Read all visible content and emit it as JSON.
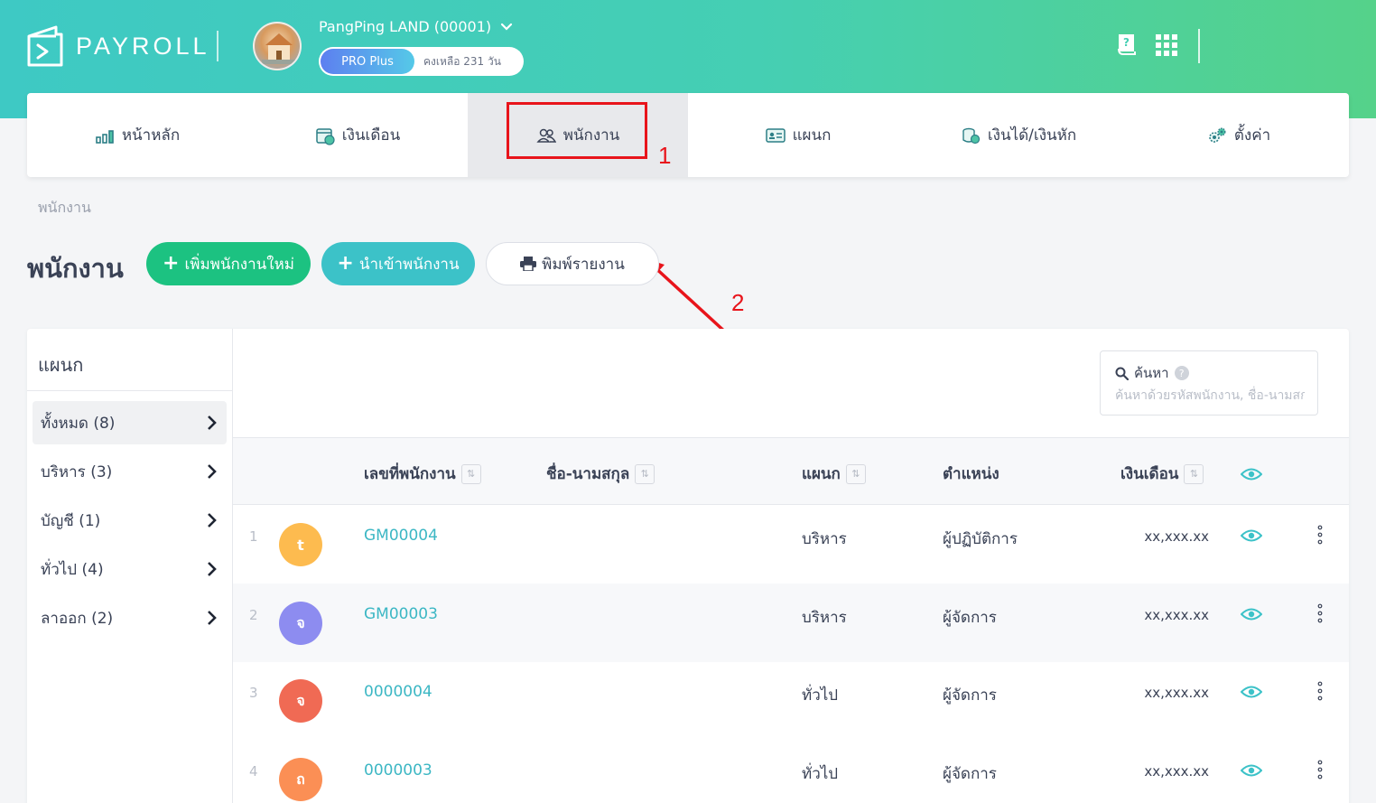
{
  "header": {
    "logo_text": "PAYROLL",
    "company_name": "PangPing LAND (00001)",
    "plan_badge": "PRO Plus",
    "plan_remaining": "คงเหลือ 231 วัน",
    "icons": [
      "help-book-icon",
      "apps-grid-icon"
    ]
  },
  "nav": {
    "items": [
      {
        "label": "หน้าหลัก",
        "icon": "bar-chart-icon"
      },
      {
        "label": "เงินเดือน",
        "icon": "calendar-money-icon"
      },
      {
        "label": "พนักงาน",
        "icon": "people-icon"
      },
      {
        "label": "แผนก",
        "icon": "id-card-icon"
      },
      {
        "label": "เงินได้/เงินหัก",
        "icon": "coins-icon"
      },
      {
        "label": "ตั้งค่า",
        "icon": "gears-icon"
      }
    ],
    "active_index": 2
  },
  "annotations": {
    "one": "1",
    "two": "2",
    "color": "#e8141b"
  },
  "breadcrumb": "พนักงาน",
  "page": {
    "title": "พนักงาน",
    "add_button": "เพิ่มพนักงานใหม่",
    "import_button": "นำเข้าพนักงาน",
    "print_button": "พิมพ์รายงาน"
  },
  "sidebar": {
    "title": "แผนก",
    "items": [
      {
        "label": "ทั้งหมด (8)"
      },
      {
        "label": "บริหาร (3)"
      },
      {
        "label": "บัญชี (1)"
      },
      {
        "label": "ทั่วไป (4)"
      },
      {
        "label": "ลาออก (2)"
      }
    ]
  },
  "search": {
    "label": "ค้นหา",
    "placeholder": "ค้นหาด้วยรหัสพนักงาน, ชื่อ-นามสกุล"
  },
  "table": {
    "headers": {
      "code": "เลขที่พนักงาน",
      "name": "ชื่อ-นามสกุล",
      "dept": "แผนก",
      "position": "ตำแหน่ง",
      "salary": "เงินเดือน"
    },
    "rows": [
      {
        "index": "1",
        "avatar": "t",
        "avatar_color": "#fdbb4f",
        "code": "GM00004",
        "dept": "บริหาร",
        "position": "ผู้ปฏิบัติการ",
        "salary": "xx,xxx.xx"
      },
      {
        "index": "2",
        "avatar": "จ",
        "avatar_color": "#8d8cf0",
        "code": "GM00003",
        "dept": "บริหาร",
        "position": "ผู้จัดการ",
        "salary": "xx,xxx.xx"
      },
      {
        "index": "3",
        "avatar": "จ",
        "avatar_color": "#f06a54",
        "code": "0000004",
        "dept": "ทั่วไป",
        "position": "ผู้จัดการ",
        "salary": "xx,xxx.xx"
      },
      {
        "index": "4",
        "avatar": "ถ",
        "avatar_color": "#fb8f55",
        "code": "0000003",
        "dept": "ทั่วไป",
        "position": "ผู้จัดการ",
        "salary": "xx,xxx.xx"
      }
    ]
  },
  "colors": {
    "accent_teal": "#3cc2c8",
    "accent_green": "#1cc281",
    "link": "#3cb7c4"
  }
}
